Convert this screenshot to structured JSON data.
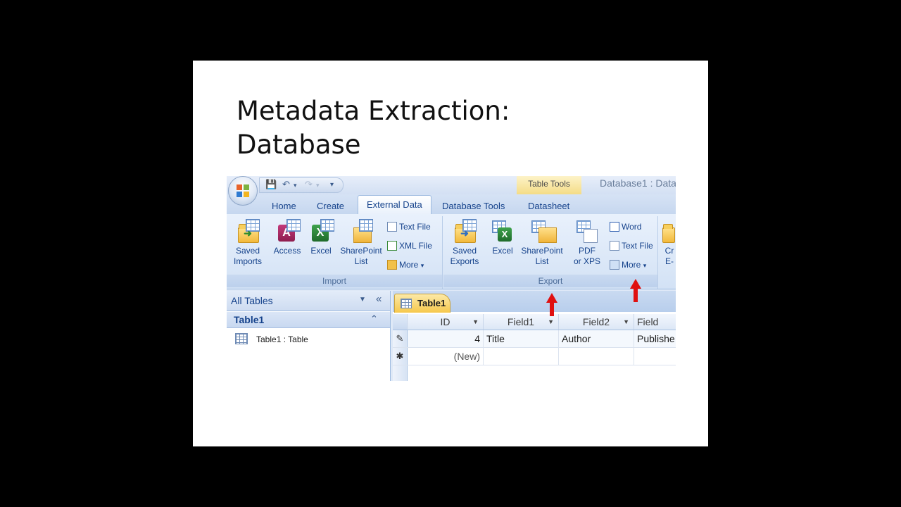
{
  "slide": {
    "title_line1": "Metadata Extraction:",
    "title_line2": "Database"
  },
  "window": {
    "context_tab": "Table Tools",
    "title": "Database1 : Data"
  },
  "ribbon_tabs": [
    "Home",
    "Create",
    "External Data",
    "Database Tools",
    "Datasheet"
  ],
  "import_group": {
    "label": "Import",
    "saved_imports": "Saved\nImports",
    "access": "Access",
    "excel": "Excel",
    "sharepoint": "SharePoint\nList",
    "text_file": "Text File",
    "xml_file": "XML File",
    "more": "More"
  },
  "export_group": {
    "label": "Export",
    "saved_exports": "Saved\nExports",
    "excel": "Excel",
    "sharepoint": "SharePoint\nList",
    "pdf": "PDF\nor XPS",
    "word": "Word",
    "text_file": "Text File",
    "more": "More"
  },
  "collect_group": {
    "partial_label": "Cr\nE-"
  },
  "nav_pane": {
    "header": "All Tables",
    "group": "Table1",
    "item": "Table1 : Table"
  },
  "datasheet": {
    "tab": "Table1",
    "columns": [
      "ID",
      "Field1",
      "Field2",
      "Field"
    ],
    "row1": {
      "id": "4",
      "field1": "Title",
      "field2": "Author",
      "field3": "Publishe"
    },
    "new_row": "(New)"
  },
  "colors": {
    "arrow": "#e01010",
    "ribbon_text": "#15428b"
  }
}
